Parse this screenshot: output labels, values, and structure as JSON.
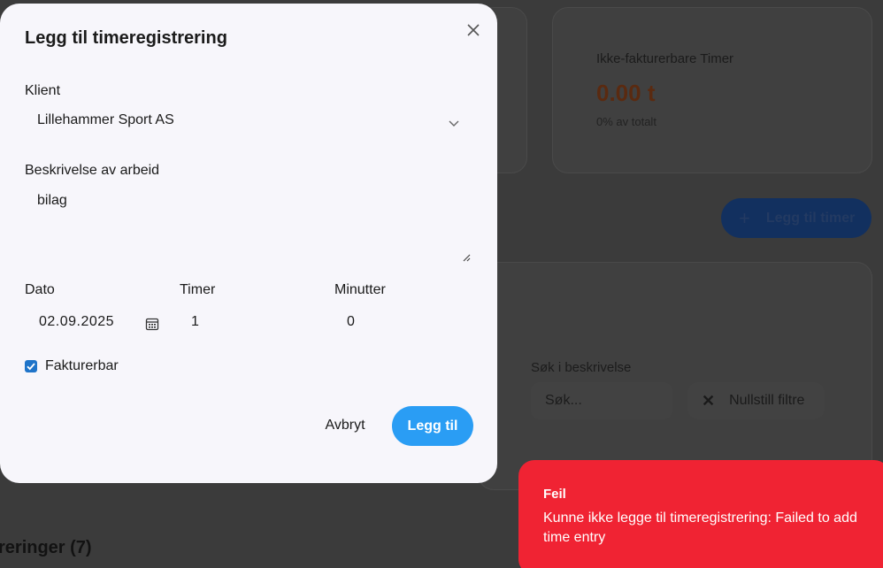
{
  "background": {
    "stat_card": {
      "label": "Ikke-fakturerbare Timer",
      "value": "0.00 t",
      "sub": "0% av totalt"
    },
    "add_hours_button": {
      "icon": "plus-icon",
      "label": "Legg til timer"
    },
    "search": {
      "label": "Søk i beskrivelse",
      "placeholder": "Søk..."
    },
    "reset_filters_button": {
      "icon": "close-icon",
      "label": "Nullstill filtre"
    },
    "list_heading": "reringer (7)"
  },
  "modal": {
    "title": "Legg til timeregistrering",
    "close_icon": "close-icon",
    "client": {
      "label": "Klient",
      "value": "Lillehammer Sport AS",
      "icon": "chevron-down-icon"
    },
    "description": {
      "label": "Beskrivelse av arbeid",
      "value": "bilag"
    },
    "date": {
      "label": "Dato",
      "value": "02.09.2025",
      "icon": "calendar-icon"
    },
    "hours": {
      "label": "Timer",
      "value": "1"
    },
    "minutes": {
      "label": "Minutter",
      "value": "0"
    },
    "billable": {
      "label": "Fakturerbar",
      "checked": true
    },
    "cancel_label": "Avbryt",
    "submit_label": "Legg til"
  },
  "toast": {
    "title": "Feil",
    "message": "Kunne ikke legge til timeregistrering: Failed to add time entry"
  },
  "colors": {
    "primary": "#2a9df4",
    "error": "#f02333",
    "checkbox": "#1f74c9"
  }
}
